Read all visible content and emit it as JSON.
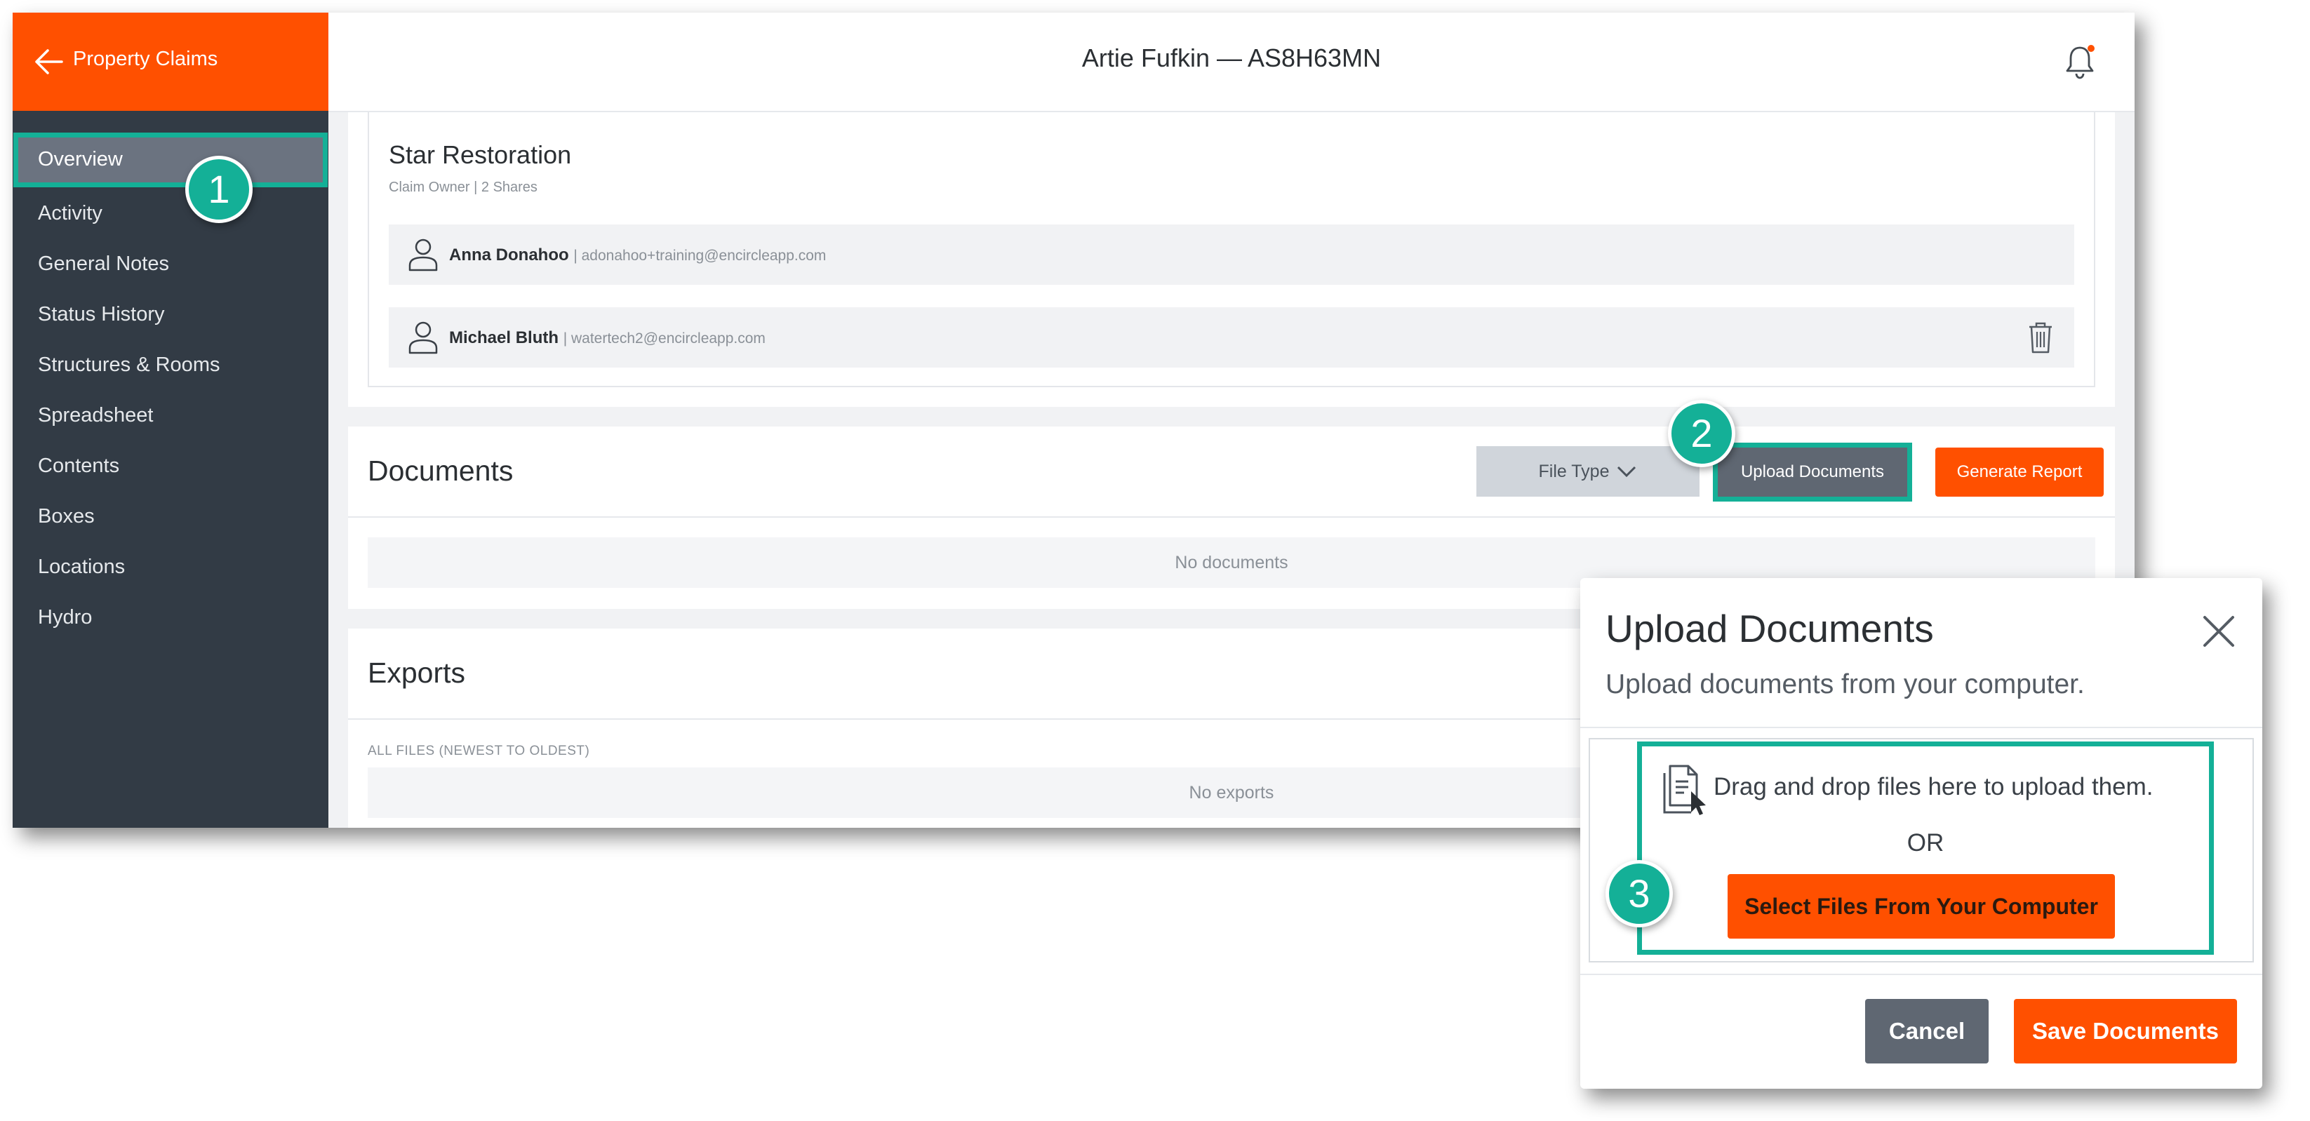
{
  "sidebar": {
    "header_title": "Property Claims",
    "items": [
      {
        "label": "Overview",
        "active": true
      },
      {
        "label": "Activity"
      },
      {
        "label": "General Notes"
      },
      {
        "label": "Status History"
      },
      {
        "label": "Structures & Rooms"
      },
      {
        "label": "Spreadsheet"
      },
      {
        "label": "Contents"
      },
      {
        "label": "Boxes"
      },
      {
        "label": "Locations"
      },
      {
        "label": "Hydro"
      }
    ]
  },
  "header": {
    "title": "Artie Fufkin — AS8H63MN",
    "bell_icon": "bell-icon",
    "notification_dot_color": "#ff5000"
  },
  "team": {
    "name": "Star Restoration",
    "subtitle": "Claim Owner | 2 Shares",
    "members": [
      {
        "name": "Anna Donahoo",
        "email": "| adonahoo+training@encircleapp.com"
      },
      {
        "name": "Michael Bluth",
        "email": "| watertech2@encircleapp.com"
      }
    ]
  },
  "documents": {
    "title": "Documents",
    "file_type_label": "File Type",
    "upload_label": "Upload Documents",
    "generate_label": "Generate Report",
    "empty_text": "No documents"
  },
  "exports": {
    "title": "Exports",
    "files_label": "ALL FILES (NEWEST TO OLDEST)",
    "empty_text": "No exports"
  },
  "modal": {
    "title": "Upload Documents",
    "subtitle": "Upload documents from your computer.",
    "drag_text": "Drag and drop files here to upload them.",
    "or_text": "OR",
    "select_label": "Select Files From Your Computer",
    "cancel_label": "Cancel",
    "save_label": "Save Documents"
  },
  "steps": [
    "1",
    "2",
    "3"
  ],
  "colors": {
    "brand_orange": "#ff5000",
    "sidebar_bg": "#323b45",
    "highlight_teal": "#14b097",
    "secondary_button": "#5f6772"
  }
}
